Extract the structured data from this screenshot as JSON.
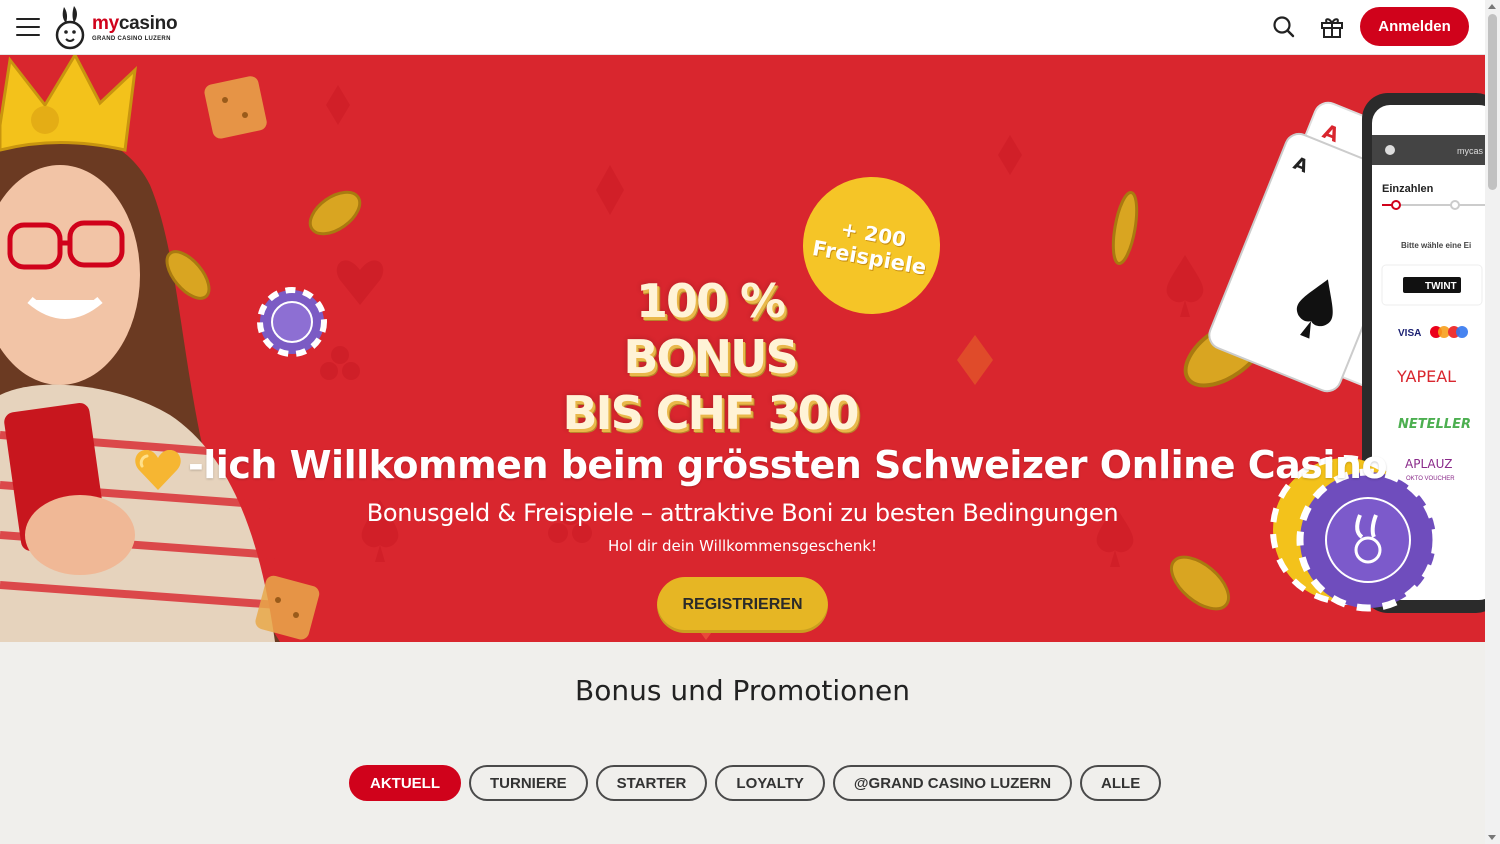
{
  "header": {
    "logo_main_prefix": "my",
    "logo_main_suffix": "casino",
    "logo_sub": "GRAND CASINO LUZERN",
    "login_label": "Anmelden",
    "icons": [
      "hamburger-icon",
      "bunny-logo-icon",
      "search-icon",
      "gift-icon"
    ]
  },
  "hero": {
    "title_line1": "100 % BONUS",
    "title_line2": "BIS CHF 300",
    "badge_line1": "+ 200",
    "badge_line2": "Freispiele",
    "welcome": "-lich Willkommen beim grössten Schweizer Online Casino",
    "subtitle": "Bonusgeld & Freispiele – attraktive Boni zu besten Bedingungen",
    "tagline": "Hol dir dein Willkommensgeschenk!",
    "cta_label": "REGISTRIEREN",
    "phone": {
      "brand": "mycas",
      "heading": "Einzahlen",
      "prompt": "Bitte wähle eine Ei",
      "methods": [
        "TWINT",
        "VISA",
        "YAPEAL",
        "NETELLER",
        "APLAUZ"
      ],
      "method_sub": "OKTO VOUCHER"
    }
  },
  "promotions": {
    "title": "Bonus und Promotionen",
    "tabs": [
      {
        "label": "AKTUELL",
        "active": true
      },
      {
        "label": "TURNIERE",
        "active": false
      },
      {
        "label": "STARTER",
        "active": false
      },
      {
        "label": "LOYALTY",
        "active": false
      },
      {
        "label": "@GRAND CASINO LUZERN",
        "active": false
      },
      {
        "label": "ALLE",
        "active": false
      }
    ]
  },
  "colors": {
    "brand_red": "#d0021b",
    "hero_red": "#d9262e",
    "gold": "#e6b624",
    "badge_yellow": "#f5c527",
    "page_bg": "#f0efec"
  }
}
